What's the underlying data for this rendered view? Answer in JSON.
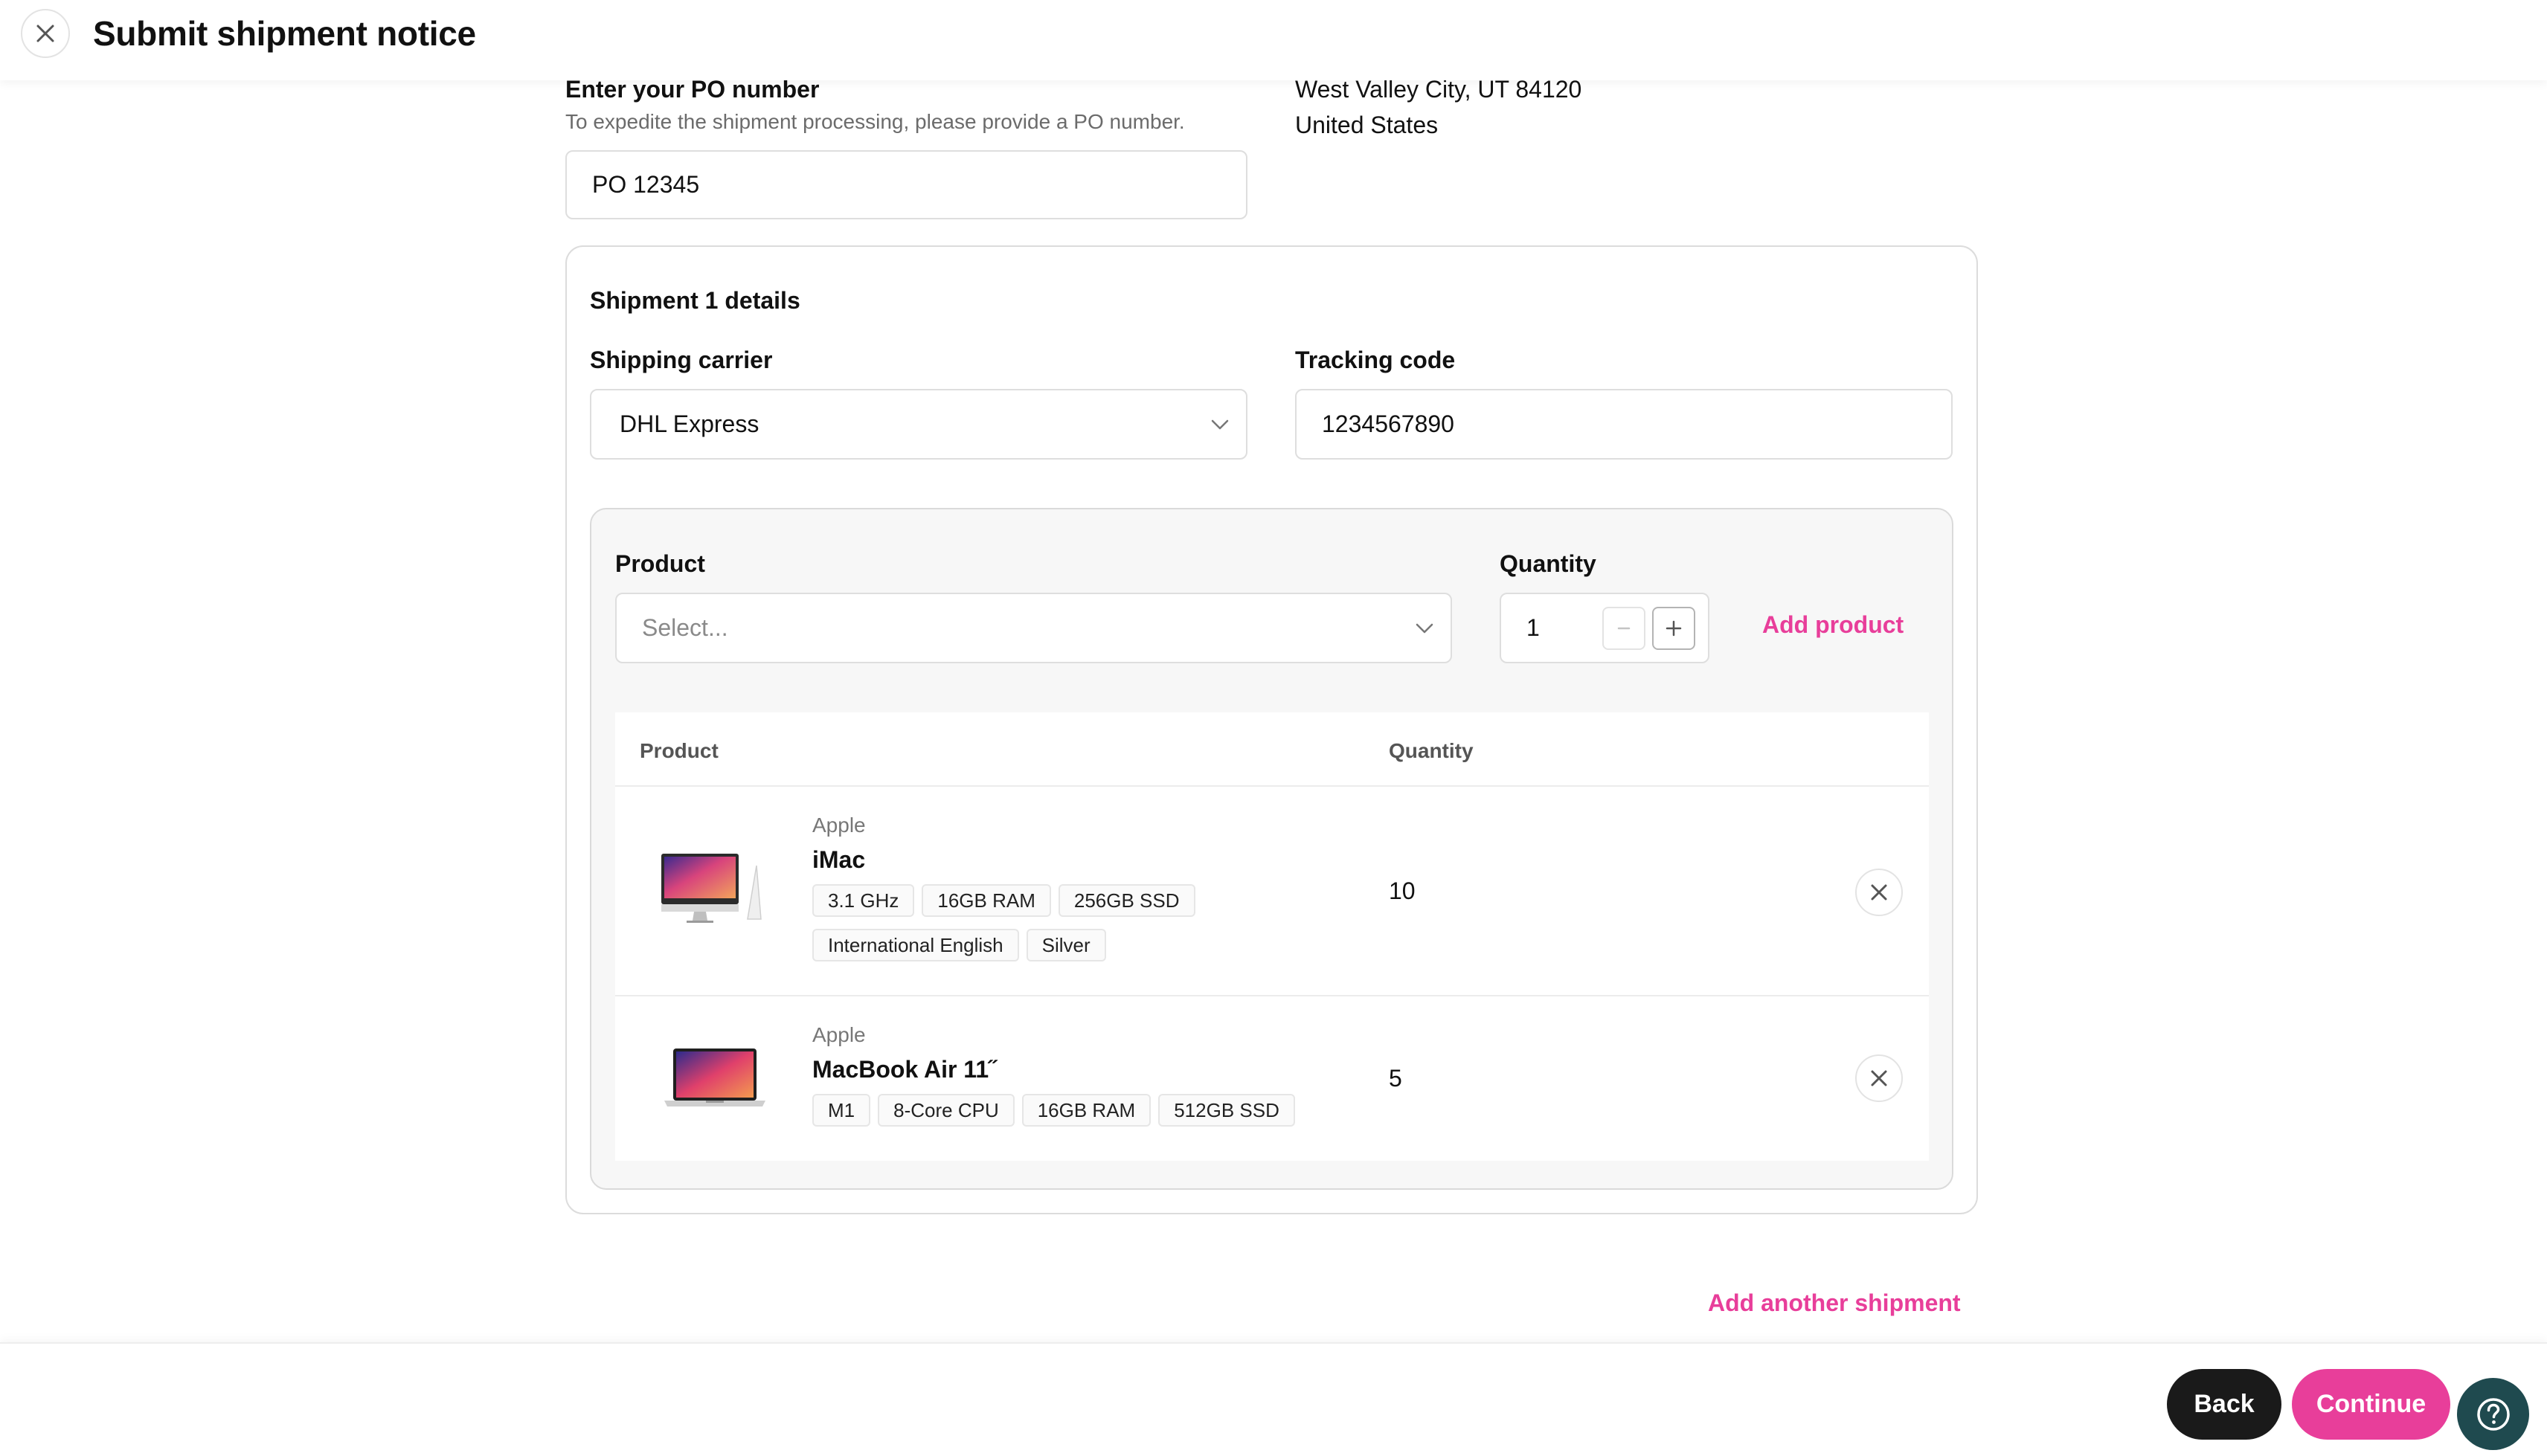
{
  "header": {
    "title": "Submit shipment notice"
  },
  "po": {
    "label": "Enter your PO number",
    "help": "To expedite the shipment processing, please provide a PO number.",
    "value": "PO 12345"
  },
  "address": {
    "line1": "West Valley City, UT 84120",
    "line2": "United States"
  },
  "shipment": {
    "title": "Shipment 1 details",
    "carrier_label": "Shipping carrier",
    "carrier_value": "DHL Express",
    "tracking_label": "Tracking code",
    "tracking_value": "1234567890"
  },
  "product_form": {
    "product_label": "Product",
    "product_placeholder": "Select...",
    "quantity_label": "Quantity",
    "quantity_value": "1",
    "add_product": "Add product"
  },
  "table": {
    "headers": {
      "product": "Product",
      "quantity": "Quantity"
    },
    "rows": [
      {
        "brand": "Apple",
        "name": "iMac",
        "tags": [
          "3.1 GHz",
          "16GB RAM",
          "256GB SSD",
          "International English",
          "Silver"
        ],
        "quantity": "10"
      },
      {
        "brand": "Apple",
        "name": "MacBook Air 11˝",
        "tags": [
          "M1",
          "8-Core CPU",
          "16GB RAM",
          "512GB SSD"
        ],
        "quantity": "5"
      }
    ]
  },
  "add_shipment": "Add another shipment",
  "footer": {
    "back": "Back",
    "continue": "Continue"
  },
  "icons": {
    "close": "close-icon",
    "chevron": "chevron-down-icon",
    "minus": "minus-icon",
    "plus": "plus-icon",
    "remove": "close-icon",
    "help": "question-mark-icon",
    "imac": "imac-thumbnail",
    "macbook": "macbook-thumbnail"
  },
  "colors": {
    "accent": "#e83e9a",
    "dark": "#1a1a1a",
    "help": "#1f4a4f"
  }
}
